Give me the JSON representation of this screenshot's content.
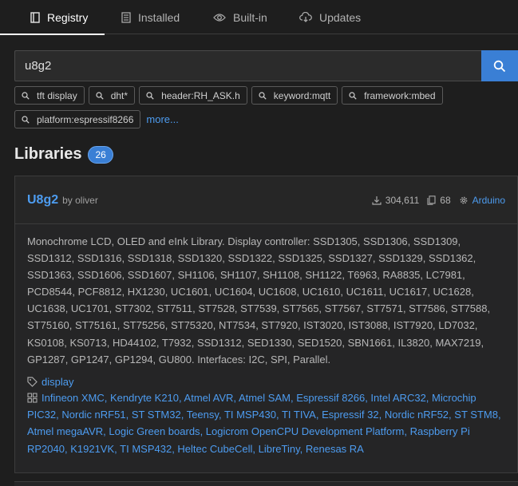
{
  "tabs": [
    {
      "label": "Registry",
      "icon": "book-icon",
      "active": true
    },
    {
      "label": "Installed",
      "icon": "installed-list-icon"
    },
    {
      "label": "Built-in",
      "icon": "eye-icon"
    },
    {
      "label": "Updates",
      "icon": "cloud-download-icon"
    }
  ],
  "search": {
    "value": "u8g2",
    "button_icon": "search-icon"
  },
  "chips": {
    "row1": [
      "tft display",
      "dht*",
      "header:RH_ASK.h",
      "keyword:mqtt",
      "framework:mbed"
    ],
    "row2": [
      "platform:espressif8266"
    ],
    "more": "more..."
  },
  "libraries": {
    "title": "Libraries",
    "count": "26"
  },
  "card": {
    "name": "U8g2",
    "by": "by oliver",
    "downloads": "304,611",
    "examples": "68",
    "platform": "Arduino",
    "description": "Monochrome LCD, OLED and eInk Library. Display controller: SSD1305, SSD1306, SSD1309, SSD1312, SSD1316, SSD1318, SSD1320, SSD1322, SSD1325, SSD1327, SSD1329, SSD1362, SSD1363, SSD1606, SSD1607, SH1106, SH1107, SH1108, SH1122, T6963, RA8835, LC7981, PCD8544, PCF8812, HX1230, UC1601, UC1604, UC1608, UC1610, UC1611, UC1617, UC1628, UC1638, UC1701, ST7302, ST7511, ST7528, ST7539, ST7565, ST7567, ST7571, ST7586, ST7588, ST75160, ST75161, ST75256, ST75320, NT7534, ST7920, IST3020, IST3088, IST7920, LD7032, KS0108, KS0713, HD44102, T7932, SSD1312, SED1330, SED1520, SBN1661, IL3820, MAX7219, GP1287, GP1247, GP1294, GU800. Interfaces: I2C, SPI, Parallel.",
    "keyword": "display",
    "platforms": [
      "Infineon XMC",
      "Kendryte K210",
      "Atmel AVR",
      "Atmel SAM",
      "Espressif 8266",
      "Intel ARC32",
      "Microchip PIC32",
      "Nordic nRF51",
      "ST STM32",
      "Teensy",
      "TI MSP430",
      "TI TIVA",
      "Espressif 32",
      "Nordic nRF52",
      "ST STM8",
      "Atmel megaAVR",
      "Logic Green boards",
      "Logicrom OpenCPU Development Platform",
      "Raspberry Pi RP2040",
      "K1921VK",
      "TI MSP432",
      "Heltec CubeCell",
      "LibreTiny",
      "Renesas RA"
    ]
  },
  "colors": {
    "background": "#1e1e1e",
    "accent": "#3a7fd5",
    "link": "#4d9cf0"
  }
}
